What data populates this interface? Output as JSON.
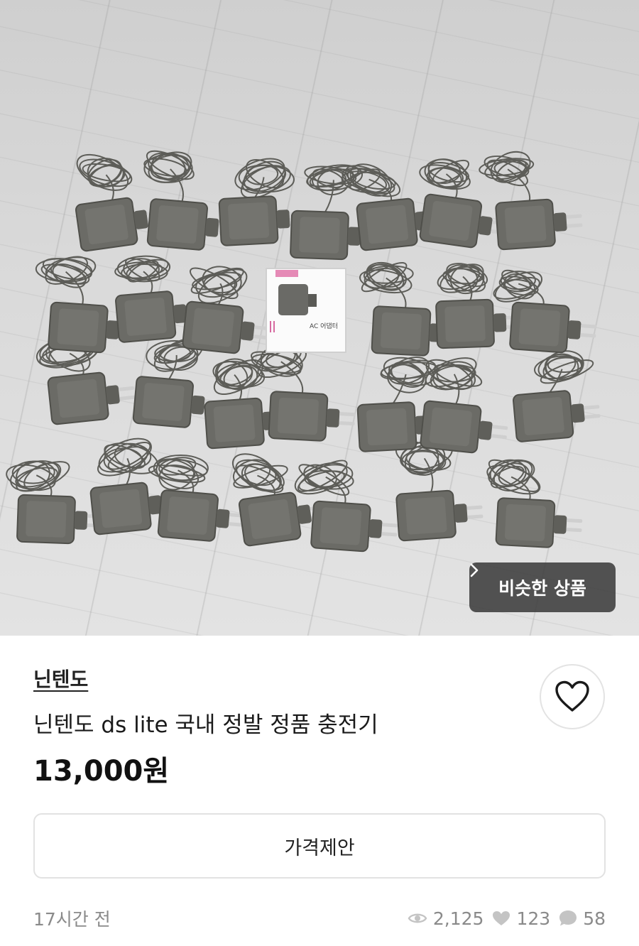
{
  "photo": {
    "alt": "",
    "box_label_top": "",
    "box_label": "AC 어댑터"
  },
  "similar": {
    "label": "비슷한 상품",
    "icon": "chevron-right-icon"
  },
  "product": {
    "brand": "닌텐도",
    "title": "닌텐도 ds lite 국내 정발 정품 충전기",
    "price": "13,000원"
  },
  "actions": {
    "favorite_icon": "heart-outline-icon",
    "offer_label": "가격제안"
  },
  "meta": {
    "posted": "17시간 전",
    "views": "2,125",
    "likes": "123",
    "chats": "58"
  },
  "colors": {
    "chip_bg": "#3c3c3c",
    "text_muted": "#8a8a8a",
    "border": "#e2e2e2"
  }
}
